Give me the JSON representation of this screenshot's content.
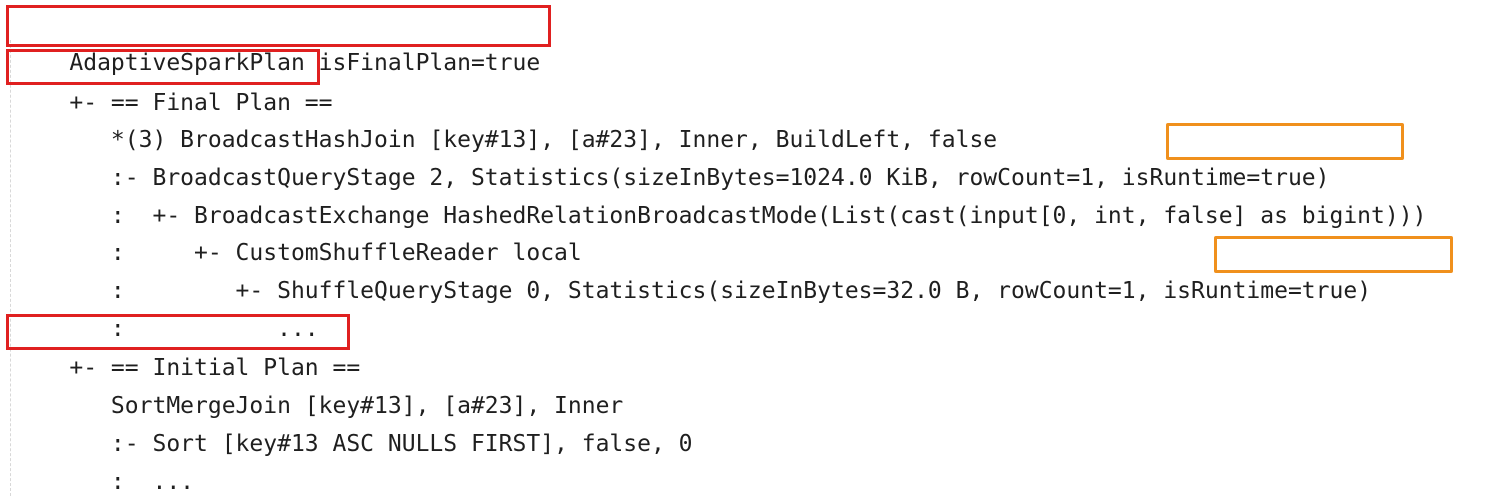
{
  "plan": {
    "lines": [
      {
        "text": "AdaptiveSparkPlan isFinalPlan=true"
      },
      {
        "text": "+- == Final Plan =="
      },
      {
        "text": "   *(3) BroadcastHashJoin [key#13], [a#23], Inner, BuildLeft, false"
      },
      {
        "text": "   :- BroadcastQueryStage 2, Statistics(sizeInBytes=1024.0 KiB, rowCount=1, ",
        "highlight": "isRuntime=true)"
      },
      {
        "text": "   :  +- BroadcastExchange HashedRelationBroadcastMode(List(cast(input[0, int, false] as bigint)))"
      },
      {
        "text": "   :     +- CustomShuffleReader local"
      },
      {
        "text": "   :        +- ShuffleQueryStage 0, Statistics(sizeInBytes=32.0 B, rowCount=1, ",
        "highlight": "isRuntime=true)"
      },
      {
        "text": "   :           ..."
      },
      {
        "text": "+- == Initial Plan =="
      },
      {
        "text": "   SortMergeJoin [key#13], [a#23], Inner"
      },
      {
        "text": "   :- Sort [key#13 ASC NULLS FIRST], false, 0"
      },
      {
        "text": "   :  ..."
      }
    ]
  },
  "colors": {
    "plan_header_box": "#e02020",
    "runtime_box": "#f0901c"
  }
}
